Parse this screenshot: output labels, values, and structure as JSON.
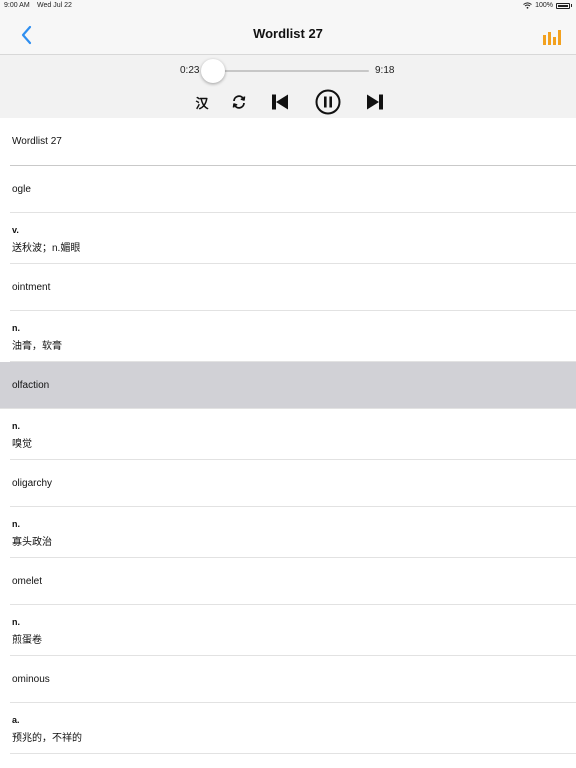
{
  "status": {
    "time": "9:00 AM",
    "date": "Wed Jul 22",
    "battery": "100%"
  },
  "nav": {
    "title": "Wordlist 27",
    "back_icon": "chevron-left-icon",
    "menu_icon": "bar-chart-icon",
    "accent": "#f2a11f"
  },
  "player": {
    "current_time": "0:23",
    "total_time": "9:18",
    "progress": 0.04,
    "lang_toggle": "汉",
    "accent": "#1a8fe8"
  },
  "list": {
    "header": "Wordlist 27",
    "entries": [
      {
        "word": "ogle",
        "pos": "v.",
        "meaning": "送秋波；n.媚眼"
      },
      {
        "word": "ointment",
        "pos": "n.",
        "meaning": "油膏，软膏"
      },
      {
        "word": "olfaction",
        "pos": "n.",
        "meaning": "嗅觉",
        "selected": true
      },
      {
        "word": "oligarchy",
        "pos": "n.",
        "meaning": "寡头政治"
      },
      {
        "word": "omelet",
        "pos": "n.",
        "meaning": "煎蛋卷"
      },
      {
        "word": "ominous",
        "pos": "a.",
        "meaning": "预兆的，不祥的"
      }
    ]
  }
}
